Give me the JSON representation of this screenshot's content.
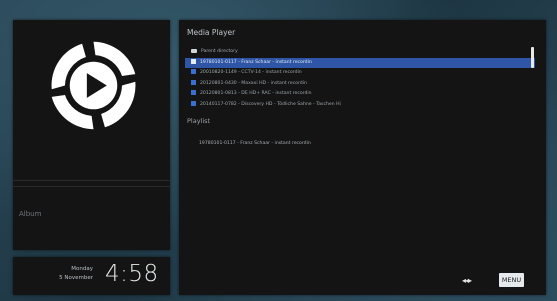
{
  "left_panel": {
    "album_label": "Album"
  },
  "clock": {
    "weekday": "Monday",
    "date": "5 November",
    "time": "4:58"
  },
  "media_player": {
    "title": "Media Player",
    "items": [
      {
        "label": "Parent directory",
        "icon": "folder-icon",
        "selected": false
      },
      {
        "label": "19780101-0117 - Franz Schaar - instant recordin",
        "icon": "video-icon",
        "selected": true
      },
      {
        "label": "20010820-1149 - CCTV-14 - instant recordin",
        "icon": "video-icon",
        "selected": false
      },
      {
        "label": "20120801-0430 - Maxaxi HD - instant recordin",
        "icon": "video-icon",
        "selected": false
      },
      {
        "label": "20120801-0813 - DE HD+ RAC - instant recordin",
        "icon": "video-icon",
        "selected": false
      },
      {
        "label": "20140117-0782 - Discovery HD - Tödliche Sahne - Taschen Hi",
        "icon": "video-icon",
        "selected": false
      }
    ],
    "playlist_label": "Playlist",
    "playlist_item": "19780101-0117 - Franz Schaar - instant recordin"
  },
  "bottom_bar": {
    "arrows_label": "◂◂▸",
    "menu_label": "MENU"
  },
  "colors": {
    "selection": "#2f56a6",
    "panel": "#141414",
    "background": "#24404f"
  }
}
